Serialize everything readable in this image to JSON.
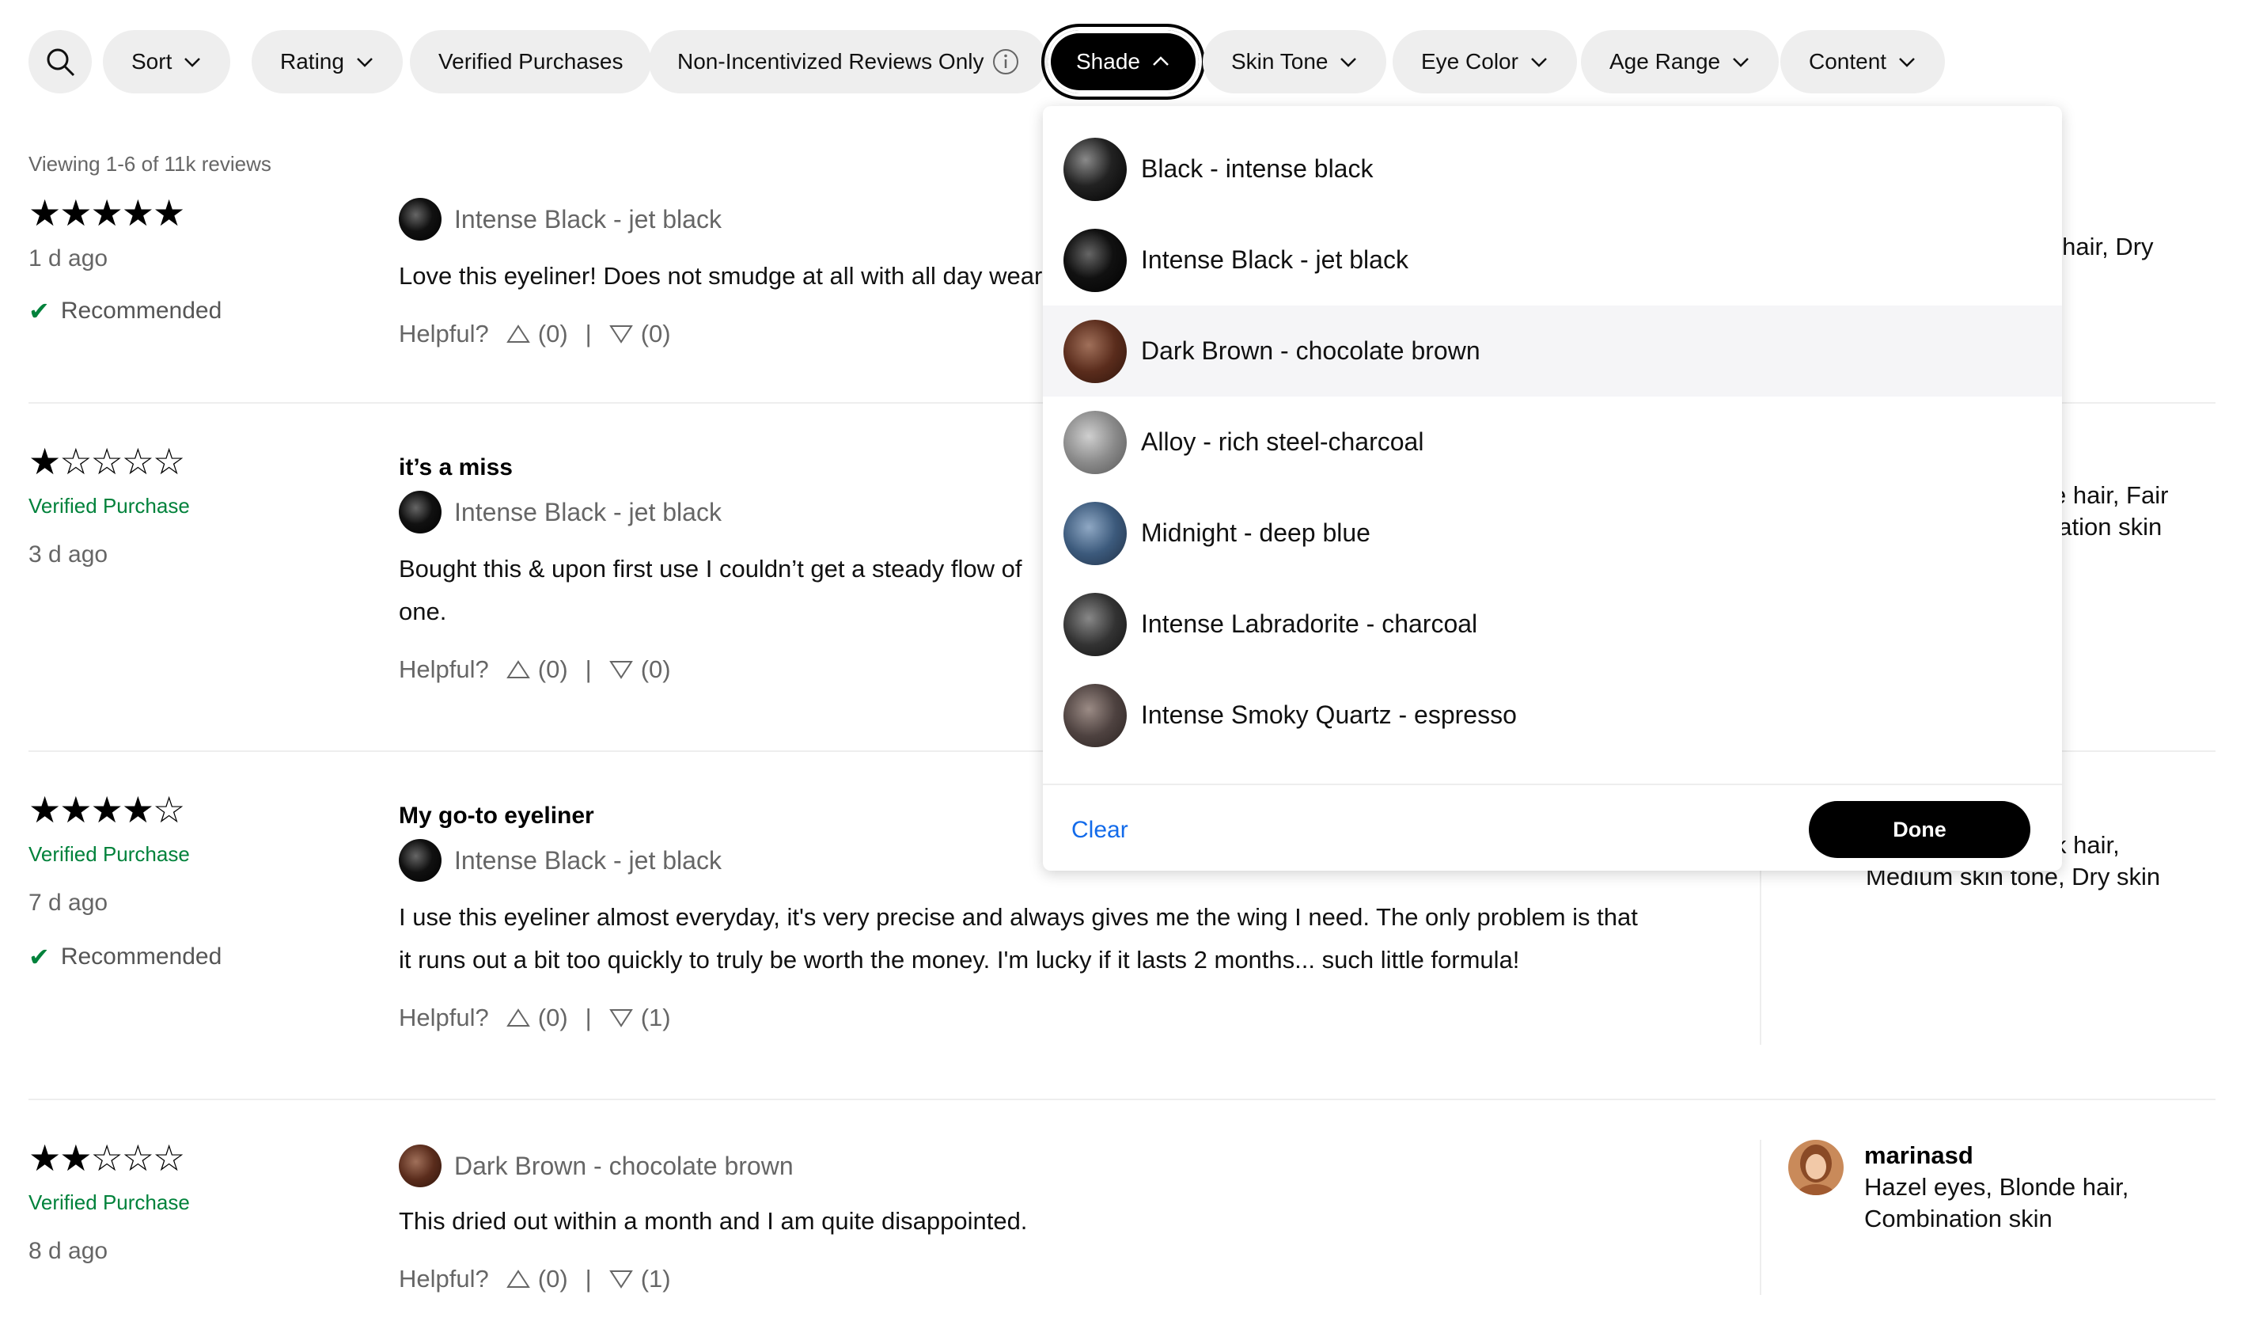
{
  "filters": {
    "sort": "Sort",
    "rating": "Rating",
    "verified": "Verified Purchases",
    "non_incentivized": "Non-Incentivized Reviews Only",
    "shade": "Shade",
    "skin_tone": "Skin Tone",
    "eye_color": "Eye Color",
    "age_range": "Age Range",
    "content": "Content"
  },
  "viewing": "Viewing 1-6 of 11k reviews",
  "labels": {
    "helpful": "Helpful?",
    "recommended": "Recommended",
    "verified_purchase": "Verified Purchase",
    "separator": "|"
  },
  "reviews": [
    {
      "stars": "★★★★★",
      "date": "1 d ago",
      "shade": "Intense Black - jet black",
      "text_line1": "Love this eyeliner! Does not smudge at all with all day wear",
      "up": "(0)",
      "down": "(0)",
      "user_partial": "k hair, Dry"
    },
    {
      "stars": "★☆☆☆☆",
      "title": "it’s a miss",
      "date": "3 d ago",
      "shade": "Intense Black - jet black",
      "text_line1": "Bought this & upon first use I couldn’t get a steady flow of",
      "text_line2": "one.",
      "up": "(0)",
      "down": "(0)",
      "user_partial_1": "e hair, Fair",
      "user_partial_2": "nation skin"
    },
    {
      "stars": "★★★★☆",
      "title": "My go-to eyeliner",
      "date": "7 d ago",
      "shade": "Intense Black - jet black",
      "text_line1": "I use this eyeliner almost everyday, it's very precise and always gives me the wing I need. The only problem is that",
      "text_line2": "it runs out a bit too quickly to truly be worth the money. I'm lucky if it lasts 2 months... such little formula!",
      "up": "(0)",
      "down": "(1)",
      "user_partial_1": "k hair,",
      "user_partial_2": "Medium skin tone, Dry skin"
    },
    {
      "stars": "★★☆☆☆",
      "date": "8 d ago",
      "shade": "Dark Brown - chocolate brown",
      "text_line1": "This dried out within a month and I am quite disappointed.",
      "up": "(0)",
      "down": "(1)",
      "user_name": "marinasd",
      "user_desc": "Hazel eyes, Blonde hair, Combination skin"
    }
  ],
  "shade_dropdown": {
    "options": [
      {
        "label": "Black - intense black",
        "color": "#1a1a1a"
      },
      {
        "label": "Intense Black - jet black",
        "color": "#000000"
      },
      {
        "label": "Dark Brown - chocolate brown",
        "color": "#5a2c1c"
      },
      {
        "label": "Alloy - rich steel-charcoal",
        "color": "#8a8a8a"
      },
      {
        "label": "Midnight - deep blue",
        "color": "#3c5a7c"
      },
      {
        "label": "Intense Labradorite - charcoal",
        "color": "#333333"
      },
      {
        "label": "Intense Smoky Quartz - espresso",
        "color": "#4e4240"
      }
    ],
    "clear": "Clear",
    "done": "Done"
  },
  "colors": {
    "verified_green": "#00823b",
    "link_blue": "#136bea",
    "pill_bg": "#eeeeee"
  }
}
